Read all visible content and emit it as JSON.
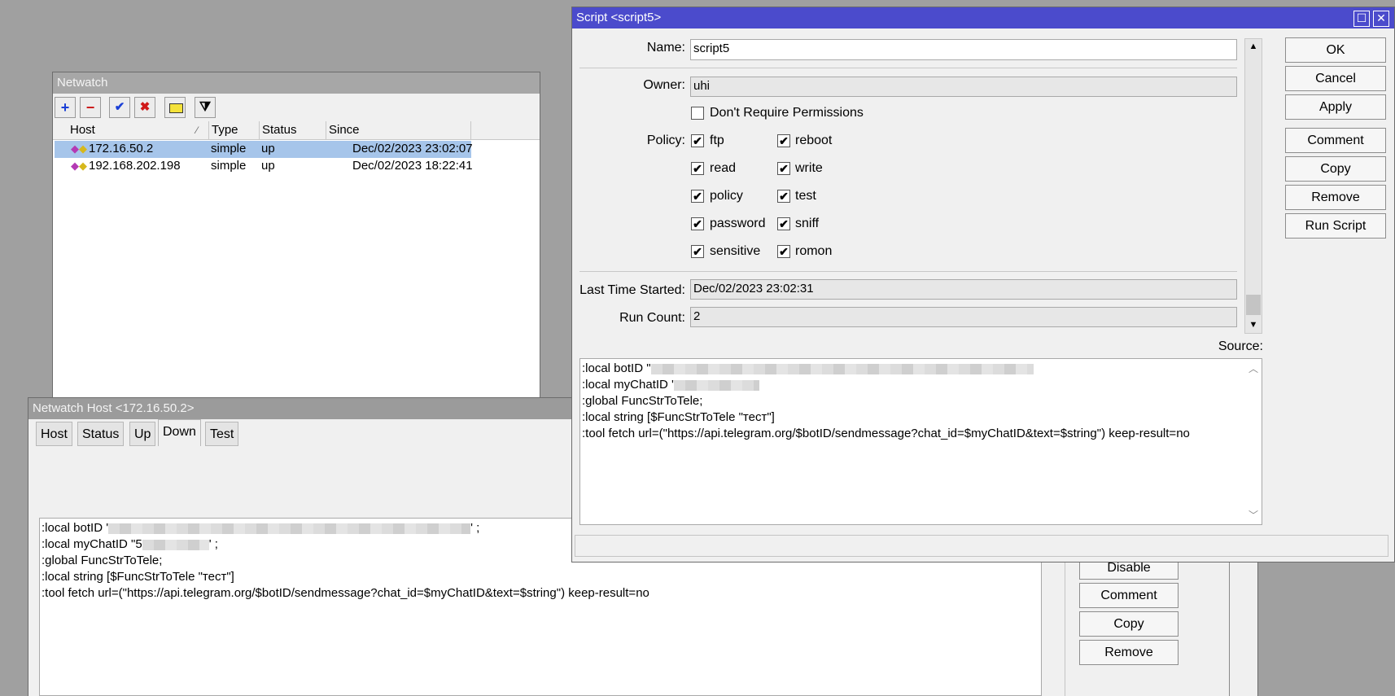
{
  "netwatch": {
    "title": "Netwatch",
    "columns": [
      "Host",
      "Type",
      "Status",
      "Since"
    ],
    "sort_indicator": "⁄",
    "rows": [
      {
        "host": "172.16.50.2",
        "type": "simple",
        "status": "up",
        "since": "Dec/02/2023 23:02:07"
      },
      {
        "host": "192.168.202.198",
        "type": "simple",
        "status": "up",
        "since": "Dec/02/2023 18:22:41"
      }
    ]
  },
  "host_window": {
    "title": "Netwatch Host <172.16.50.2>",
    "tabs": [
      "Host",
      "Status",
      "Up",
      "Down",
      "Test"
    ],
    "selected_tab": "Down",
    "code": {
      "l1_pre": ":local botID '",
      "l1_post": "' ;",
      "l2_pre": ":local myChatID \"5",
      "l2_post": "' ;",
      "l3": ":global FuncStrToTele;",
      "l4": ":local string [$FuncStrToTele \"тест\"]",
      "l5": ":tool fetch url=(\"https://api.telegram.org/$botID/sendmessage?chat_id=$myChatID&text=$string\") keep-result=no"
    },
    "buttons": {
      "disable": "Disable",
      "comment": "Comment",
      "copy": "Copy",
      "remove": "Remove"
    }
  },
  "script_window": {
    "title": "Script <script5>",
    "name_label": "Name:",
    "name_value": "script5",
    "owner_label": "Owner:",
    "owner_value": "uhi",
    "dont_require": "Don't Require Permissions",
    "policy_label": "Policy:",
    "policies_left": [
      "ftp",
      "read",
      "policy",
      "password",
      "sensitive"
    ],
    "policies_right": [
      "reboot",
      "write",
      "test",
      "sniff",
      "romon"
    ],
    "last_time_label": "Last Time Started:",
    "last_time_value": "Dec/02/2023 23:02:31",
    "run_count_label": "Run Count:",
    "run_count_value": "2",
    "source_label": "Source:",
    "code": {
      "l1_pre": ":local botID \"",
      "l2_pre": ":local myChatID '",
      "l3": ":global FuncStrToTele;",
      "l4": ":local string [$FuncStrToTele \"тест\"]",
      "l5": ":tool fetch url=(\"https://api.telegram.org/$botID/sendmessage?chat_id=$myChatID&text=$string\") keep-result=no"
    },
    "buttons": {
      "ok": "OK",
      "cancel": "Cancel",
      "apply": "Apply",
      "comment": "Comment",
      "copy": "Copy",
      "remove": "Remove",
      "run_script": "Run Script"
    }
  },
  "icons": {
    "check": "✔",
    "add": "+",
    "remove": "−",
    "enable": "✔",
    "disable": "✖",
    "filter": "⧩",
    "maximize": "☐",
    "close": "✕",
    "arrow_up": "▲",
    "arrow_down": "▼",
    "chev_up": "︿",
    "chev_down": "﹀"
  }
}
